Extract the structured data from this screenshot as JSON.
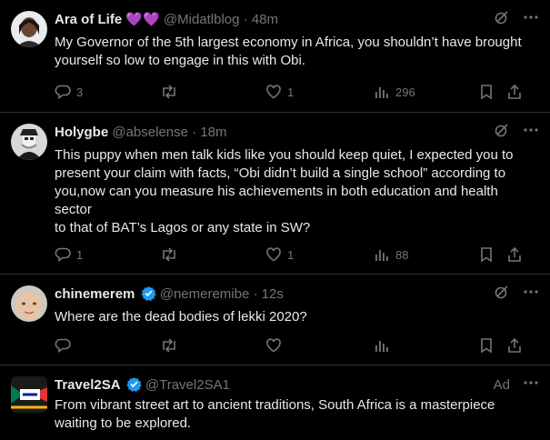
{
  "tweets": [
    {
      "name": "Ara of Life",
      "name_emoji": "💜💜",
      "handle": "@Midatlblog",
      "separator": "·",
      "time": "48m",
      "text": "My Governor of the 5th largest economy in Africa, you shouldn’t have brought yourself so low to engage in this with Obi.",
      "replies": "3",
      "retweets": "",
      "likes": "1",
      "views": "296"
    },
    {
      "name": "Holygbe",
      "handle": "@abselense",
      "separator": "·",
      "time": "18m",
      "text": "This puppy when men talk kids like you should keep quiet, I expected you to present your claim with facts, “Obi didn’t build a single school” according to you,now can you measure his achievements in both education and health sector\nto that of BAT’s Lagos or any state in SW?",
      "replies": "1",
      "retweets": "",
      "likes": "1",
      "views": "88"
    },
    {
      "name": "chinemerem",
      "handle": "@nemeremibe",
      "separator": "·",
      "time": "12s",
      "text": "Where are the dead bodies of lekki 2020?",
      "replies": "",
      "retweets": "",
      "likes": "",
      "views": ""
    },
    {
      "name": "Travel2SA",
      "handle": "@Travel2SA1",
      "ad_label": "Ad",
      "text": "From vibrant street art to ancient traditions, South Africa is a masterpiece waiting to be explored."
    }
  ],
  "icons": {
    "grok": "grok-icon",
    "more": "more-icon",
    "reply": "reply-icon",
    "retweet": "retweet-icon",
    "like": "heart-icon",
    "views": "views-icon",
    "bookmark": "bookmark-icon",
    "share": "share-icon",
    "verified": "verified-badge-icon"
  },
  "colors": {
    "background": "#000000",
    "text": "#e7e9ea",
    "muted": "#71767b",
    "divider": "#2f3336",
    "verified": "#1d9bf0",
    "heart_emoji": "#ab7de0"
  }
}
